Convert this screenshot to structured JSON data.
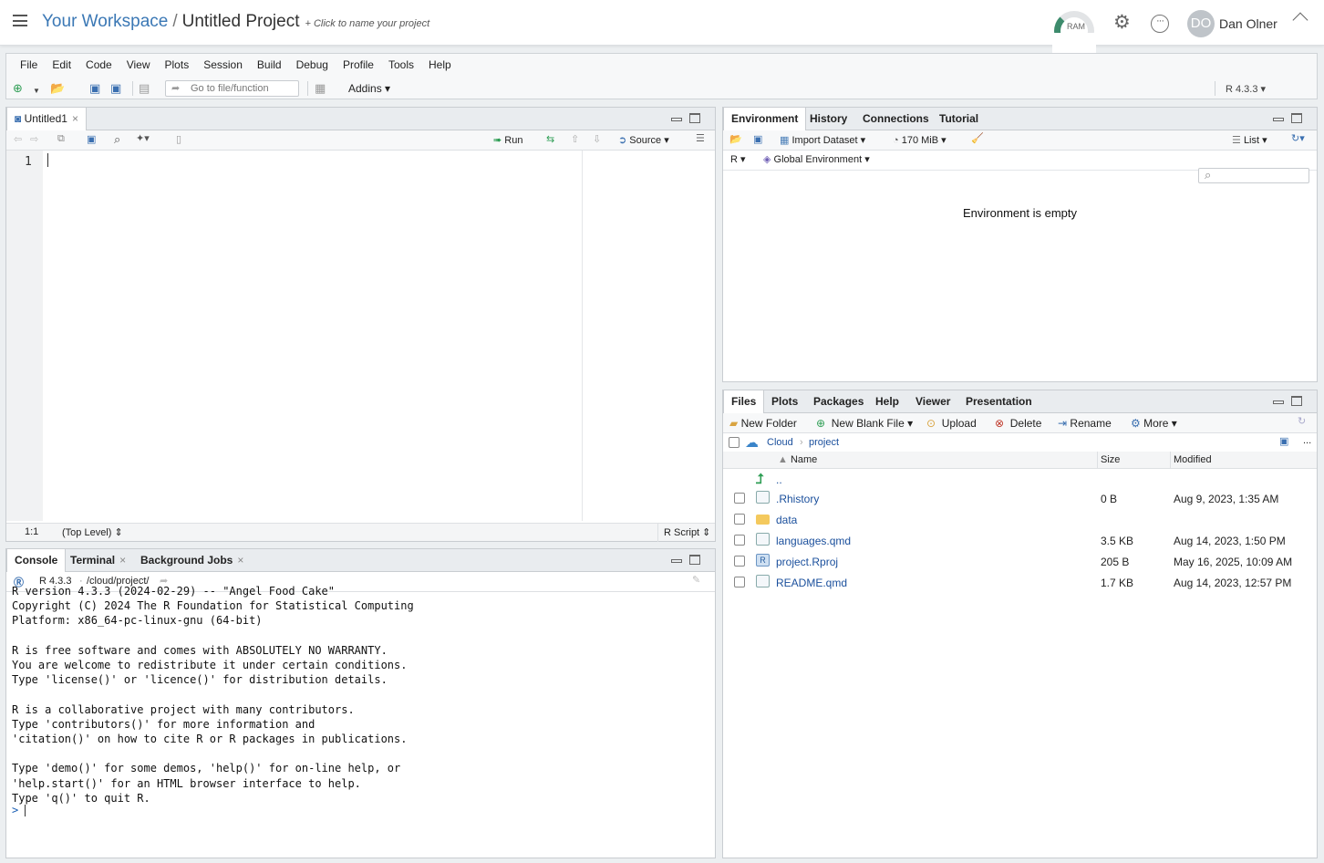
{
  "header": {
    "workspace": "Your Workspace",
    "separator": "/",
    "project": "Untitled Project",
    "hint": "+ Click to name your project",
    "ram_label": "RAM",
    "user_initials": "DO",
    "user_name": "Dan Olner"
  },
  "menubar": {
    "items": [
      "File",
      "Edit",
      "Code",
      "View",
      "Plots",
      "Session",
      "Build",
      "Debug",
      "Profile",
      "Tools",
      "Help"
    ],
    "goto_placeholder": "Go to file/function",
    "addins": "Addins",
    "r_version": "R 4.3.3"
  },
  "editor": {
    "tab": "Untitled1",
    "run": "Run",
    "source": "Source",
    "line_number": "1",
    "cursor_pos": "1:1",
    "scope": "(Top Level)",
    "filetype": "R Script"
  },
  "console": {
    "tabs": [
      "Console",
      "Terminal",
      "Background Jobs"
    ],
    "r_version": "R 4.3.3",
    "path": "/cloud/project/",
    "text": "R version 4.3.3 (2024-02-29) -- \"Angel Food Cake\"\nCopyright (C) 2024 The R Foundation for Statistical Computing\nPlatform: x86_64-pc-linux-gnu (64-bit)\n\nR is free software and comes with ABSOLUTELY NO WARRANTY.\nYou are welcome to redistribute it under certain conditions.\nType 'license()' or 'licence()' for distribution details.\n\nR is a collaborative project with many contributors.\nType 'contributors()' for more information and\n'citation()' on how to cite R or R packages in publications.\n\nType 'demo()' for some demos, 'help()' for on-line help, or\n'help.start()' for an HTML browser interface to help.\nType 'q()' to quit R.",
    "prompt": ">"
  },
  "environment": {
    "tabs": [
      "Environment",
      "History",
      "Connections",
      "Tutorial"
    ],
    "import": "Import Dataset",
    "memory": "170 MiB",
    "view": "List",
    "lang": "R",
    "scope": "Global Environment",
    "empty": "Environment is empty"
  },
  "files": {
    "tabs": [
      "Files",
      "Plots",
      "Packages",
      "Help",
      "Viewer",
      "Presentation"
    ],
    "actions": [
      "New Folder",
      "New Blank File",
      "Upload",
      "Delete",
      "Rename",
      "More"
    ],
    "breadcrumb": [
      "Cloud",
      "project"
    ],
    "more_dots": "...",
    "columns": {
      "name": "Name",
      "size": "Size",
      "modified": "Modified"
    },
    "up": "..",
    "rows": [
      {
        "name": ".Rhistory",
        "size": "0 B",
        "modified": "Aug 9, 2023, 1:35 AM",
        "icon": "history-file-icon"
      },
      {
        "name": "data",
        "size": "",
        "modified": "",
        "icon": "folder-icon"
      },
      {
        "name": "languages.qmd",
        "size": "3.5 KB",
        "modified": "Aug 14, 2023, 1:50 PM",
        "icon": "quarto-file-icon"
      },
      {
        "name": "project.Rproj",
        "size": "205 B",
        "modified": "May 16, 2025, 10:09 AM",
        "icon": "rproj-file-icon"
      },
      {
        "name": "README.qmd",
        "size": "1.7 KB",
        "modified": "Aug 14, 2023, 12:57 PM",
        "icon": "quarto-file-icon"
      }
    ]
  },
  "colors": {
    "accent": "#3b78b5",
    "link": "#1a4f9c",
    "green": "#2f9e55"
  }
}
